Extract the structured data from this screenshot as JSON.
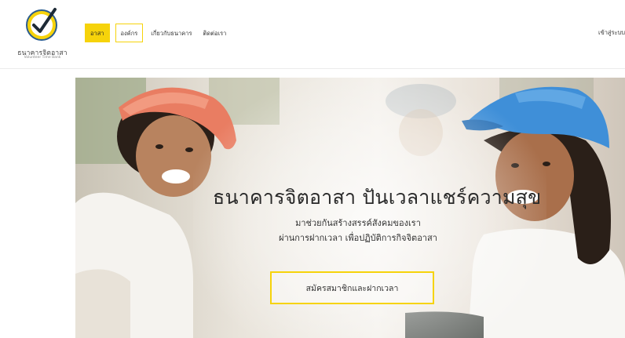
{
  "brand": {
    "name": "ธนาคารจิตอาสา",
    "tagline": "Volunteer Time Bank",
    "accent_color": "#f6d30b"
  },
  "nav": {
    "items": [
      {
        "label": "อาสา",
        "style": "filled"
      },
      {
        "label": "องค์กร",
        "style": "outlined"
      },
      {
        "label": "เกี่ยวกับธนาคาร",
        "style": "plain"
      },
      {
        "label": "ติดต่อเรา",
        "style": "plain"
      }
    ],
    "login_label": "เข้าสู่ระบบ"
  },
  "hero": {
    "title": "ธนาคารจิตอาสา ปันเวลาแชร์ความสุข",
    "subtitle_line1": "มาช่วยกันสร้างสรรค์สังคมของเรา",
    "subtitle_line2": "ผ่านการฝากเวลา เพื่อปฏิบัติการกิจจิตอาสา",
    "cta_label": "สมัครสมาชิกและฝากเวลา",
    "image_description_icon": "volunteers-photo"
  }
}
